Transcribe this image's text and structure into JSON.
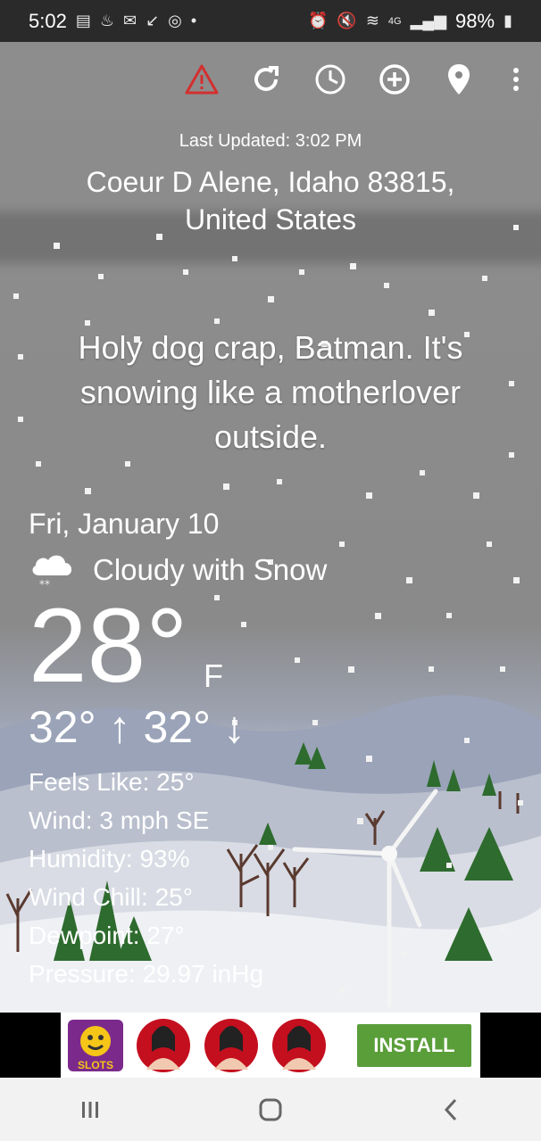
{
  "status_bar": {
    "time": "5:02",
    "battery": "98%",
    "network": "4G"
  },
  "toolbar": {
    "icons": [
      "warning-icon",
      "refresh-icon",
      "history-icon",
      "add-location-icon",
      "location-pin-icon",
      "more-vert-icon"
    ]
  },
  "header": {
    "last_updated": "Last Updated: 3:02 PM",
    "location": "Coeur D Alene, Idaho 83815, United States"
  },
  "slogan": "Holy dog crap, Batman. It's snowing like a motherlover outside.",
  "weather": {
    "date": "Fri, January 10",
    "condition": "Cloudy with Snow",
    "temperature": "28°",
    "unit": "F",
    "high": "32°",
    "low": "32°",
    "feels_like": "Feels Like: 25°",
    "wind": "Wind: 3 mph SE",
    "humidity": "Humidity: 93%",
    "wind_chill": "Wind Chill: 25°",
    "dewpoint": "Dewpoint: 27°",
    "pressure": "Pressure: 29.97 inHg"
  },
  "ad": {
    "logo_text": "SLOTS",
    "install_label": "INSTALL"
  },
  "colors": {
    "warning": "#d32f2f",
    "install_green": "#5a9e3a",
    "status_bar": "#2a2a2a"
  }
}
